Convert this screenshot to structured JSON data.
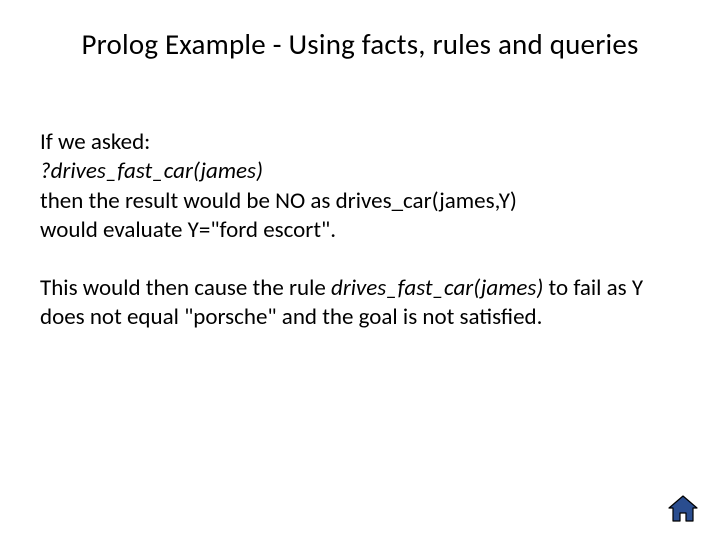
{
  "title": "Prolog Example - Using facts, rules and queries",
  "para1": {
    "l1": "If we asked:",
    "l2": "?drives_fast_car(james)",
    "l3a": "then the result would be NO as drives_car(james,Y)",
    "l3b": "would evaluate Y=\"ford escort\"."
  },
  "para2": {
    "a": "This would then cause the rule ",
    "b": "drives_fast_car(james)",
    "c": " to fail as Y does not equal \"porsche\" and the goal is not satisfied."
  },
  "icons": {
    "home": "home-icon"
  },
  "colors": {
    "home_fill": "#2a4d8f",
    "home_stroke": "#000000"
  }
}
